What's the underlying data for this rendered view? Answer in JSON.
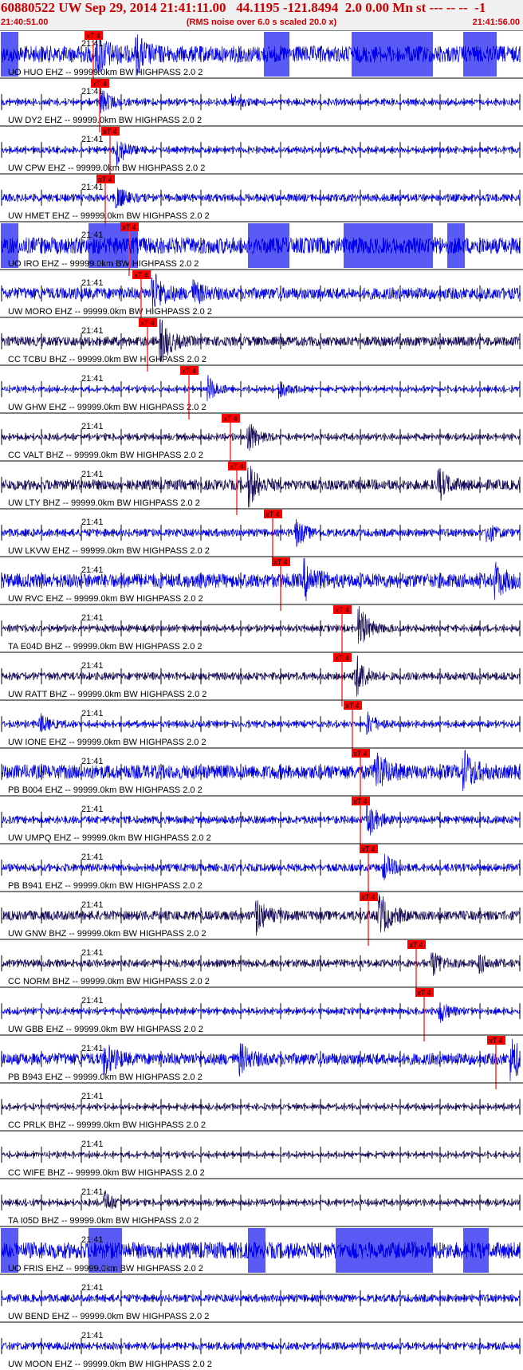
{
  "header": {
    "title": "60880522 UW Sep 29, 2014 21:41:11.00   44.1195 -121.8494  2.0 0.00 Mn st --- -- --  -1",
    "subtitle": "(RMS noise over 6.0 s scaled 20.0 x)",
    "start_time": "21:40:51.00",
    "end_time": "21:41:56.00"
  },
  "colors": {
    "accent": "#cc0000",
    "trace_blue": "#0000ee",
    "trace_dark": "#1a0a5c",
    "pick_marker": "#ff0000"
  },
  "chart_data": {
    "type": "line",
    "title": "60880522 UW Sep 29, 2014 21:41:11.00   44.1195 -121.8494  2.0 0.00 Mn st --- -- --  -1",
    "x_range_s": [
      0,
      65
    ],
    "x_start": "21:40:51.00",
    "x_end": "21:41:56.00",
    "time_tick_label": "21:41",
    "pick_label": "xT 4",
    "series": [
      {
        "name": "UO HUO EHZ -- 99999.0km BW  HIGHPASS  2.0  2",
        "pick_s": 11.5,
        "amp": 0.35,
        "clipped": [
          [
            0,
            2
          ],
          [
            33,
            36
          ],
          [
            44,
            54
          ],
          [
            58,
            62
          ]
        ],
        "bursts": [
          [
            12,
            1
          ],
          [
            17,
            0.7
          ]
        ],
        "dark": false
      },
      {
        "name": "UW DY2 EHZ -- 99999.0km BW  HIGHPASS  2.0  2",
        "pick_s": 12.3,
        "amp": 0.12,
        "clipped": [],
        "bursts": [
          [
            12.5,
            0.6
          ],
          [
            29,
            0.3
          ]
        ],
        "dark": false
      },
      {
        "name": "UW CPW EHZ -- 99999.0km BW  HIGHPASS  2.0  2",
        "pick_s": 13.6,
        "amp": 0.12,
        "clipped": [],
        "bursts": [
          [
            14.5,
            0.7
          ]
        ],
        "dark": false
      },
      {
        "name": "UW HMET EHZ -- 99999.0km BW  HIGHPASS  2.0  2",
        "pick_s": 13.0,
        "amp": 0.15,
        "clipped": [],
        "bursts": [
          [
            14.5,
            0.5
          ]
        ],
        "dark": false
      },
      {
        "name": "UO IRO EHZ -- 99999.0km BW  HIGHPASS  2.0  2",
        "pick_s": 16.0,
        "amp": 0.35,
        "clipped": [
          [
            0,
            2
          ],
          [
            11,
            17
          ],
          [
            31,
            36
          ],
          [
            43,
            54
          ],
          [
            56,
            58
          ]
        ],
        "bursts": [],
        "dark": false
      },
      {
        "name": "UW MORO EHZ -- 99999.0km BW  HIGHPASS  2.0  2",
        "pick_s": 17.5,
        "amp": 0.25,
        "clipped": [],
        "bursts": [
          [
            19,
            1
          ],
          [
            24,
            0.5
          ]
        ],
        "dark": false
      },
      {
        "name": "CC TCBU BHZ -- 99999.0km BW  HIGHPASS  2.0  2",
        "pick_s": 18.3,
        "amp": 0.2,
        "clipped": [],
        "bursts": [
          [
            20,
            1
          ]
        ],
        "dark": true
      },
      {
        "name": "UW GHW EHZ -- 99999.0km BW  HIGHPASS  2.0  2",
        "pick_s": 23.5,
        "amp": 0.1,
        "clipped": [],
        "bursts": [
          [
            26,
            0.6
          ],
          [
            35,
            0.4
          ]
        ],
        "dark": false
      },
      {
        "name": "CC VALT BHZ -- 99999.0km BW  HIGHPASS  2.0  2",
        "pick_s": 28.7,
        "amp": 0.12,
        "clipped": [],
        "bursts": [
          [
            31,
            0.8
          ]
        ],
        "dark": true
      },
      {
        "name": "UW LTY BHZ -- 99999.0km BW  HIGHPASS  2.0  2",
        "pick_s": 29.5,
        "amp": 0.22,
        "clipped": [],
        "bursts": [
          [
            31,
            1
          ],
          [
            55,
            0.6
          ]
        ],
        "dark": true
      },
      {
        "name": "UW LKVW EHZ -- 99999.0km BW  HIGHPASS  2.0  2",
        "pick_s": 34.0,
        "amp": 0.15,
        "clipped": [],
        "bursts": [
          [
            37,
            0.6
          ],
          [
            61,
            0.4
          ]
        ],
        "dark": false
      },
      {
        "name": "UW RVC EHZ -- 99999.0km BW  HIGHPASS  2.0  2",
        "pick_s": 35.0,
        "amp": 0.3,
        "clipped": [],
        "bursts": [
          [
            38,
            0.9
          ],
          [
            62,
            0.7
          ]
        ],
        "dark": false
      },
      {
        "name": "TA E04D BHZ -- 99999.0km BW  HIGHPASS  2.0  2",
        "pick_s": 42.7,
        "amp": 0.12,
        "clipped": [],
        "bursts": [
          [
            45,
            1
          ]
        ],
        "dark": true
      },
      {
        "name": "UW RATT BHZ -- 99999.0km BW  HIGHPASS  2.0  2",
        "pick_s": 42.7,
        "amp": 0.15,
        "clipped": [],
        "bursts": [
          [
            44.5,
            1
          ]
        ],
        "dark": true
      },
      {
        "name": "UW IONE EHZ -- 99999.0km BW  HIGHPASS  2.0  2",
        "pick_s": 44.0,
        "amp": 0.12,
        "clipped": [],
        "bursts": [
          [
            5,
            0.4
          ],
          [
            46,
            0.5
          ]
        ],
        "dark": false
      },
      {
        "name": "PB B004 EHZ -- 99999.0km BW  HIGHPASS  2.0  2",
        "pick_s": 45.0,
        "amp": 0.3,
        "clipped": [],
        "bursts": [
          [
            47,
            1
          ],
          [
            58,
            1
          ]
        ],
        "dark": false
      },
      {
        "name": "UW UMPQ EHZ -- 99999.0km BW  HIGHPASS  2.0  2",
        "pick_s": 45.0,
        "amp": 0.15,
        "clipped": [],
        "bursts": [
          [
            46,
            0.8
          ]
        ],
        "dark": false
      },
      {
        "name": "PB B941 EHZ -- 99999.0km BW  HIGHPASS  2.0  2",
        "pick_s": 46.0,
        "amp": 0.15,
        "clipped": [],
        "bursts": [
          [
            48,
            0.6
          ]
        ],
        "dark": false
      },
      {
        "name": "UW GNW BHZ -- 99999.0km BW  HIGHPASS  2.0  2",
        "pick_s": 46.0,
        "amp": 0.2,
        "clipped": [],
        "bursts": [
          [
            32,
            0.8
          ],
          [
            47.5,
            1
          ]
        ],
        "dark": true
      },
      {
        "name": "CC NORM BHZ -- 99999.0km BW  HIGHPASS  2.0  2",
        "pick_s": 52.0,
        "amp": 0.15,
        "clipped": [],
        "bursts": [
          [
            54,
            0.6
          ],
          [
            60,
            0.4
          ]
        ],
        "dark": true
      },
      {
        "name": "UW GBB EHZ -- 99999.0km BW  HIGHPASS  2.0  2",
        "pick_s": 53.0,
        "amp": 0.12,
        "clipped": [],
        "bursts": [
          [
            55,
            0.5
          ]
        ],
        "dark": false
      },
      {
        "name": "PB B943 EHZ -- 99999.0km BW  HIGHPASS  2.0  2",
        "pick_s": 62.0,
        "amp": 0.25,
        "clipped": [],
        "bursts": [
          [
            13,
            0.7
          ],
          [
            30,
            0.6
          ],
          [
            64,
            1
          ]
        ],
        "dark": false
      },
      {
        "name": "CC PRLK BHZ -- 99999.0km BW  HIGHPASS  2.0  2",
        "pick_s": null,
        "amp": 0.1,
        "clipped": [],
        "bursts": [],
        "dark": true
      },
      {
        "name": "CC WIFE BHZ -- 99999.0km BW  HIGHPASS  2.0  2",
        "pick_s": null,
        "amp": 0.1,
        "clipped": [],
        "bursts": [],
        "dark": true
      },
      {
        "name": "TA I05D BHZ -- 99999.0km BW  HIGHPASS  2.0  2",
        "pick_s": null,
        "amp": 0.12,
        "clipped": [],
        "bursts": [
          [
            13,
            0.5
          ]
        ],
        "dark": true
      },
      {
        "name": "UO FRIS EHZ -- 99999.0km BW  HIGHPASS  2.0  2",
        "pick_s": null,
        "amp": 0.35,
        "clipped": [
          [
            0,
            2
          ],
          [
            11,
            15
          ],
          [
            31,
            33
          ],
          [
            42,
            54
          ],
          [
            58,
            61
          ]
        ],
        "bursts": [],
        "dark": false
      },
      {
        "name": "UW BEND EHZ -- 99999.0km BW  HIGHPASS  2.0  2",
        "pick_s": null,
        "amp": 0.15,
        "clipped": [],
        "bursts": [],
        "dark": false
      },
      {
        "name": "UW MOON EHZ -- 99999.0km BW  HIGHPASS  2.0  2",
        "pick_s": null,
        "amp": 0.15,
        "clipped": [],
        "bursts": [],
        "dark": false
      }
    ]
  }
}
